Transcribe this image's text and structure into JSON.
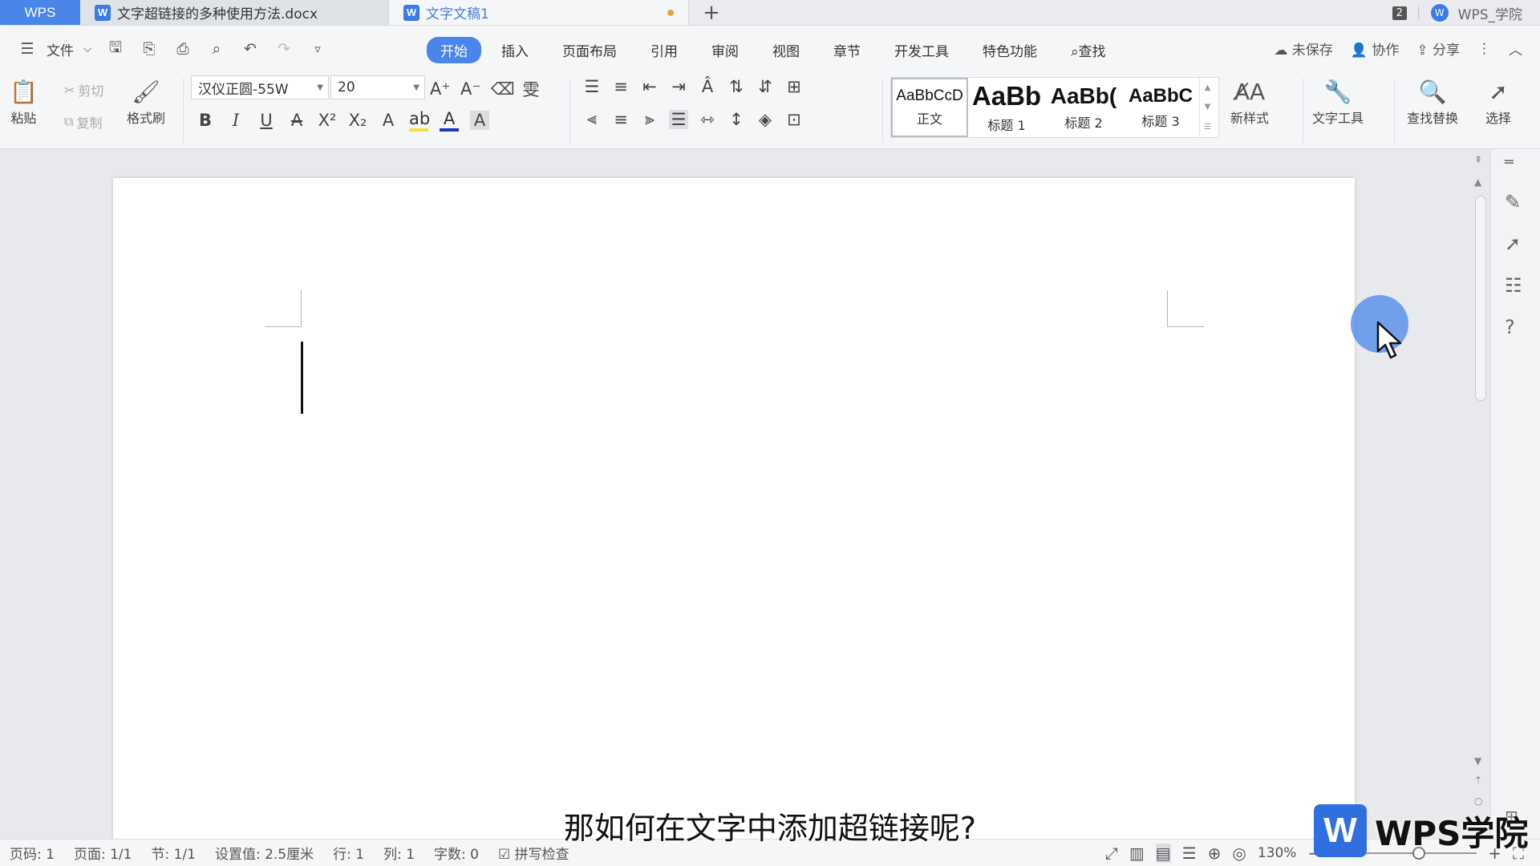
{
  "titlebar": {
    "app_tab": "WPS",
    "tabs": [
      {
        "label": "文字超链接的多种使用方法.docx"
      },
      {
        "label": "文字文稿1"
      }
    ],
    "new_tab": "+",
    "window_count": "2",
    "user": "WPS_学院"
  },
  "menubar": {
    "file_label": "文件",
    "items": [
      "开始",
      "插入",
      "页面布局",
      "引用",
      "审阅",
      "视图",
      "章节",
      "开发工具",
      "特色功能"
    ],
    "active_item": "开始",
    "search_label": "查找",
    "unsaved_label": "未保存",
    "collab_label": "协作",
    "share_label": "分享"
  },
  "ribbon": {
    "paste_label": "粘贴",
    "cut_label": "剪切",
    "copy_label": "复制",
    "format_painter_label": "格式刷",
    "font_name": "汉仪正圆-55W",
    "font_size": "20",
    "styles": [
      {
        "preview": "AaBbCcD",
        "name": "正文"
      },
      {
        "preview": "AaBb",
        "name": "标题 1"
      },
      {
        "preview": "AaBb(",
        "name": "标题 2"
      },
      {
        "preview": "AaBbC",
        "name": "标题 3"
      }
    ],
    "new_style_label": "新样式",
    "text_tools_label": "文字工具",
    "find_replace_label": "查找替换",
    "select_label": "选择"
  },
  "statusbar": {
    "page_num": "页码: 1",
    "pages": "页面: 1/1",
    "section": "节: 1/1",
    "setting": "设置值: 2.5厘米",
    "row": "行: 1",
    "col": "列: 1",
    "word_count": "字数: 0",
    "spell_check": "拼写检查",
    "zoom": "130%"
  },
  "overlay": {
    "subtitle": "那如何在文字中添加超链接呢?",
    "watermark_logo": "W",
    "watermark_text": "WPS学院"
  },
  "colors": {
    "accent": "#4a86e8",
    "cursor_highlight": "#4a86e8",
    "watermark_brand": "#2f6fe0"
  }
}
